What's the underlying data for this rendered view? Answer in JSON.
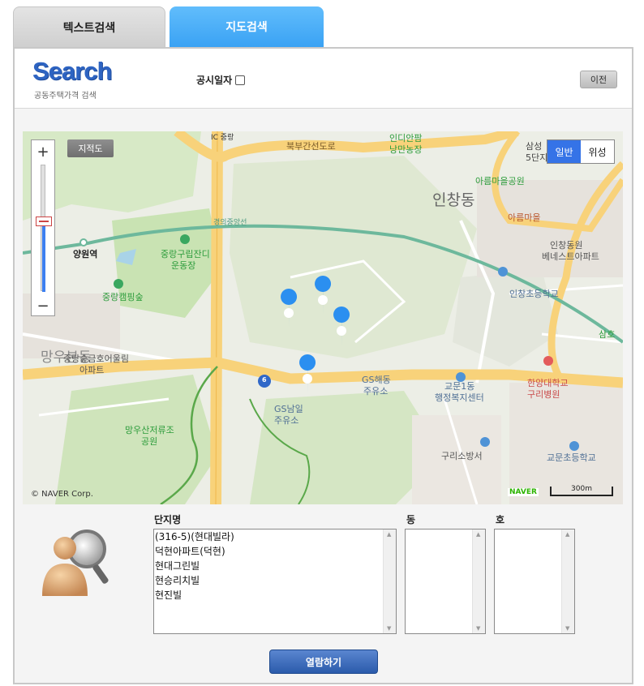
{
  "tabs": [
    {
      "label": "텍스트검색",
      "active": false
    },
    {
      "label": "지도검색",
      "active": true
    }
  ],
  "header": {
    "logo_text": "Search",
    "logo_sub": "공동주택가격 검색",
    "date_label": "공시일자",
    "prev_button": "이전"
  },
  "map": {
    "cadastral_button": "지적도",
    "zoom_in": "+",
    "zoom_out": "−",
    "zoom_level_fraction": 0.55,
    "type_normal": "일반",
    "type_satellite": "위성",
    "copyright": "© NAVER Corp.",
    "naver_logo": "NAVER",
    "scale_label": "300m",
    "labels": [
      "IC 중랑",
      "북부간선도로",
      "인디안팜",
      "낭만농장",
      "삼성",
      "5단지",
      "아름마을공원",
      "인창동",
      "아름마을",
      "경의중앙선",
      "양원역",
      "중랑구립잔디",
      "운동장",
      "인창동원",
      "베네스트아파트",
      "중랑캠핑숲",
      "인창초등학교",
      "삼호",
      "망우본동",
      "중랑숲금호어울림",
      "아파트",
      "GS해동",
      "주유소",
      "교문1동",
      "행정복지센터",
      "한양대학교",
      "구리병원",
      "GS남일",
      "주유소",
      "망우산저류조",
      "공원",
      "구리소방서",
      "교문초등학교",
      "6"
    ]
  },
  "results": {
    "complex_label": "단지명",
    "dong_label": "동",
    "ho_label": "호",
    "complex_options": [
      "(316-5)(현대빌라)",
      "덕현아파트(덕현)",
      "현대그린빌",
      "현승리치빌",
      "현진빌"
    ],
    "dong_options": [],
    "ho_options": [],
    "view_button": "열람하기"
  },
  "colors": {
    "tab_active": "#47adf8",
    "accent": "#3573e7",
    "road_major": "#f8d27a",
    "rail": "#6db89c",
    "park": "#c9e3b3"
  }
}
